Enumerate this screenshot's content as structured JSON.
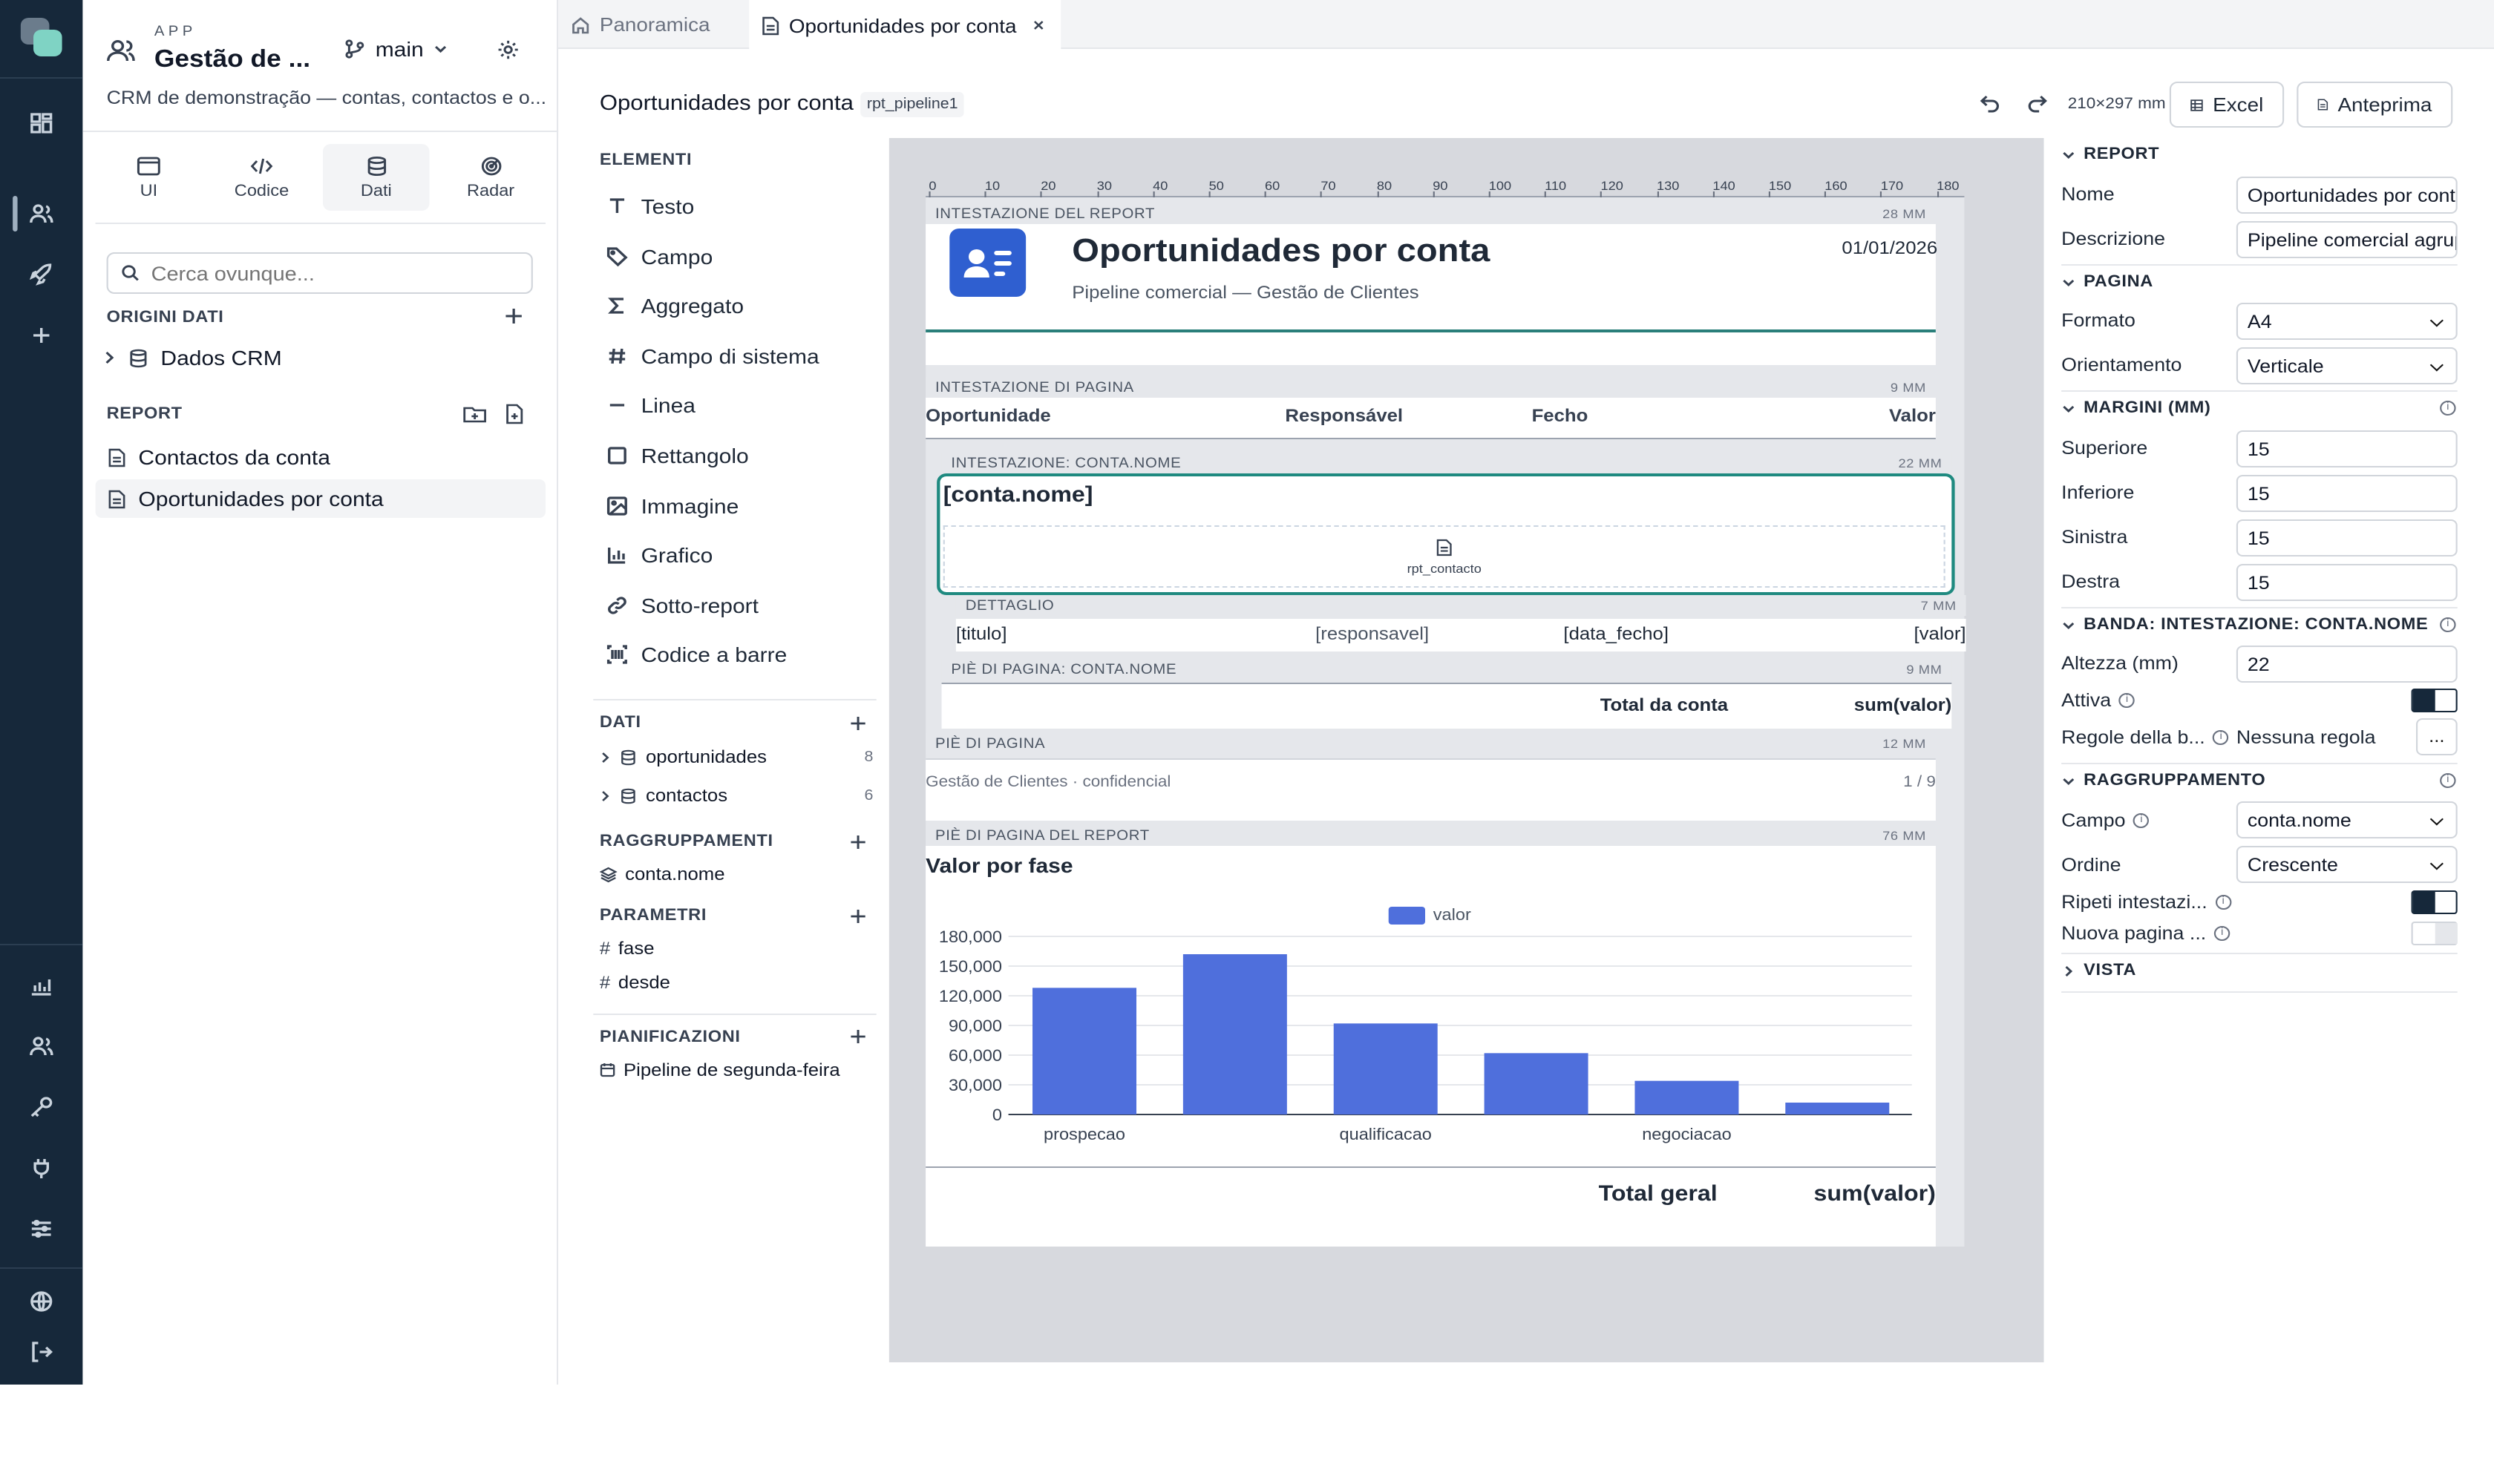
{
  "app": {
    "kicker": "APP",
    "title": "Gestão de ...",
    "branch": "main",
    "description": "CRM de demonstração — contas, contactos e o..."
  },
  "modes": [
    {
      "label": "UI",
      "icon": "browser-icon"
    },
    {
      "label": "Codice",
      "icon": "code-icon"
    },
    {
      "label": "Dati",
      "icon": "database-icon"
    },
    {
      "label": "Radar",
      "icon": "radar-icon"
    }
  ],
  "search": {
    "placeholder": "Cerca ovunque..."
  },
  "sources": {
    "title": "ORIGINI DATI",
    "items": [
      "Dados CRM"
    ]
  },
  "reports": {
    "title": "REPORT",
    "items": [
      "Contactos da conta",
      "Oportunidades por conta"
    ]
  },
  "tabs": [
    {
      "label": "Panoramica"
    },
    {
      "label": "Oportunidades por conta"
    }
  ],
  "toolbar": {
    "title": "Oportunidades por conta",
    "id": "rpt_pipeline1",
    "page_size": "210×297 mm",
    "excel": "Excel",
    "preview": "Anteprima"
  },
  "elements": {
    "title": "ELEMENTI",
    "items": [
      "Testo",
      "Campo",
      "Aggregato",
      "Campo di sistema",
      "Linea",
      "Rettangolo",
      "Immagine",
      "Grafico",
      "Sotto-report",
      "Codice a barre"
    ]
  },
  "data_panel": {
    "title": "DATI",
    "sources": [
      {
        "name": "oportunidades",
        "count": "8"
      },
      {
        "name": "contactos",
        "count": "6"
      }
    ],
    "groupings_title": "RAGGRUPPAMENTI",
    "groupings": [
      "conta.nome"
    ],
    "params_title": "PARAMETRI",
    "params": [
      "fase",
      "desde"
    ],
    "schedules_title": "PIANIFICAZIONI",
    "schedules": [
      "Pipeline de segunda-feira"
    ]
  },
  "ruler": [
    "0",
    "10",
    "20",
    "30",
    "40",
    "50",
    "60",
    "70",
    "80",
    "90",
    "100",
    "110",
    "120",
    "130",
    "140",
    "150",
    "160",
    "170",
    "180"
  ],
  "bands": {
    "report_header": {
      "label": "INTESTAZIONE DEL REPORT",
      "size": "28 MM",
      "title": "Oportunidades por conta",
      "subtitle": "Pipeline comercial — Gestão de Clientes",
      "date": "01/01/2026"
    },
    "page_header": {
      "label": "INTESTAZIONE DI PAGINA",
      "size": "9 MM",
      "cols": [
        "Oportunidade",
        "Responsável",
        "Fecho",
        "Valor"
      ]
    },
    "group_header": {
      "label": "INTESTAZIONE: CONTA.NOME",
      "size": "22 MM",
      "field": "[conta.nome]",
      "subreport": "rpt_contacto"
    },
    "detail": {
      "label": "DETTAGLIO",
      "size": "7 MM",
      "fields": [
        "[titulo]",
        "[responsavel]",
        "[data_fecho]",
        "[valor]"
      ]
    },
    "group_footer": {
      "label": "PIÈ DI PAGINA: CONTA.NOME",
      "size": "9 MM",
      "total_label": "Total da conta",
      "total_value": "sum(valor)"
    },
    "page_footer": {
      "label": "PIÈ DI PAGINA",
      "size": "12 MM",
      "left": "Gestão de Clientes · confidencial",
      "right": "1 / 9"
    },
    "report_footer": {
      "label": "PIÈ DI PAGINA DEL REPORT",
      "size": "76 MM",
      "chart_title": "Valor por fase",
      "total_label": "Total geral",
      "total_value": "sum(valor)"
    }
  },
  "chart_data": {
    "type": "bar",
    "title": "Valor por fase",
    "categories": [
      "prospecao",
      "",
      "qualificacao",
      "",
      "negociacao",
      ""
    ],
    "series": [
      {
        "name": "valor",
        "values": [
          128000,
          162000,
          92000,
          62000,
          34000,
          12000
        ]
      }
    ],
    "y_ticks": [
      "180,000",
      "150,000",
      "120,000",
      "90,000",
      "60,000",
      "30,000",
      "0"
    ],
    "ylim": [
      0,
      180000
    ],
    "grid": true,
    "legend": "top-center",
    "color": "#4f6fdc"
  },
  "props": {
    "report_section": "REPORT",
    "name_label": "Nome",
    "name_value": "Oportunidades por conta",
    "desc_label": "Descrizione",
    "desc_value": "Pipeline comercial agrupado",
    "page_section": "PAGINA",
    "format_label": "Formato",
    "format_value": "A4",
    "orient_label": "Orientamento",
    "orient_value": "Verticale",
    "margins_section": "MARGINI (MM)",
    "top_label": "Superiore",
    "top_value": "15",
    "bottom_label": "Inferiore",
    "bottom_value": "15",
    "left_label": "Sinistra",
    "left_value": "15",
    "right_label": "Destra",
    "right_value": "15",
    "band_section": "BANDA: INTESTAZIONE: CONTA.NOME",
    "height_label": "Altezza (mm)",
    "height_value": "22",
    "active_label": "Attiva",
    "rules_label": "Regole della b...",
    "rules_value": "Nessuna regola",
    "rules_button": "...",
    "group_section": "RAGGRUPPAMENTO",
    "field_label": "Campo",
    "field_value": "conta.nome",
    "order_label": "Ordine",
    "order_value": "Crescente",
    "repeat_label": "Ripeti intestazi...",
    "newpage_label": "Nuova pagina ...",
    "view_section": "VISTA"
  }
}
